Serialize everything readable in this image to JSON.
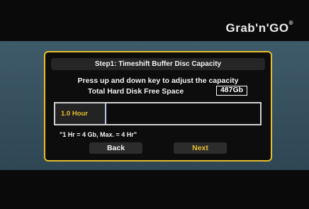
{
  "brand": {
    "name": "Grab'n'GO",
    "mark": "®"
  },
  "dialog": {
    "title": "Step1: Timeshift Buffer Disc Capacity",
    "instruction": "Press up and down key to adjust the capacity",
    "free_space_label": "Total Hard Disk Free Space",
    "free_space_value": "487Gb",
    "capacity": {
      "label": "1.0 Hour",
      "hours": 1.0,
      "max_hours": 4
    },
    "note": "\"1 Hr = 4 Gb, Max. = 4 Hr\"",
    "buttons": {
      "back": "Back",
      "next": "Next"
    }
  },
  "colors": {
    "accent": "#e7bd2b",
    "bar_fill": "#b9c7ec",
    "background": "#3e5a69"
  }
}
